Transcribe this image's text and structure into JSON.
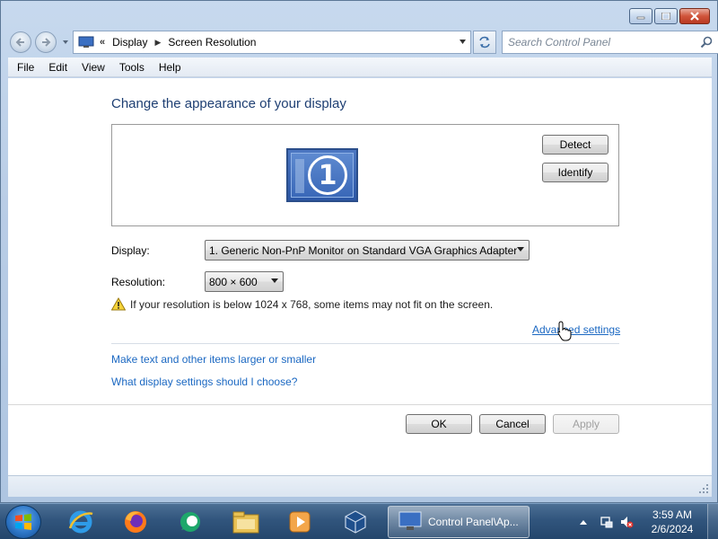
{
  "window": {
    "address": {
      "overflow_chevron": "«",
      "segments": [
        "Display",
        "Screen Resolution"
      ],
      "separator": "▶"
    },
    "search_placeholder": "Search Control Panel",
    "menu": [
      "File",
      "Edit",
      "View",
      "Tools",
      "Help"
    ]
  },
  "content": {
    "heading": "Change the appearance of your display",
    "monitor_number": "1",
    "detect_label": "Detect",
    "identify_label": "Identify",
    "display_label": "Display:",
    "display_value": "1. Generic Non-PnP Monitor on Standard VGA Graphics Adapter",
    "resolution_label": "Resolution:",
    "resolution_value": "800 × 600",
    "warning_text": "If your resolution is below 1024 x 768, some items may not fit on the screen.",
    "advanced_link": "Advanced settings",
    "link_text_size": "Make text and other items larger or smaller",
    "link_what_settings": "What display settings should I choose?",
    "ok_label": "OK",
    "cancel_label": "Cancel",
    "apply_label": "Apply"
  },
  "taskbar": {
    "active_window_label": "Control Panel\\Ap...",
    "icons": [
      "internet-explorer-icon",
      "firefox-icon",
      "chat-icon",
      "file-explorer-icon",
      "media-player-icon",
      "virtualbox-icon"
    ],
    "clock_time": "3:59 AM",
    "clock_date": "2/6/2024"
  },
  "colors": {
    "heading": "#1e3f73",
    "link": "#1b68c2",
    "taskbar": "#31557d"
  }
}
